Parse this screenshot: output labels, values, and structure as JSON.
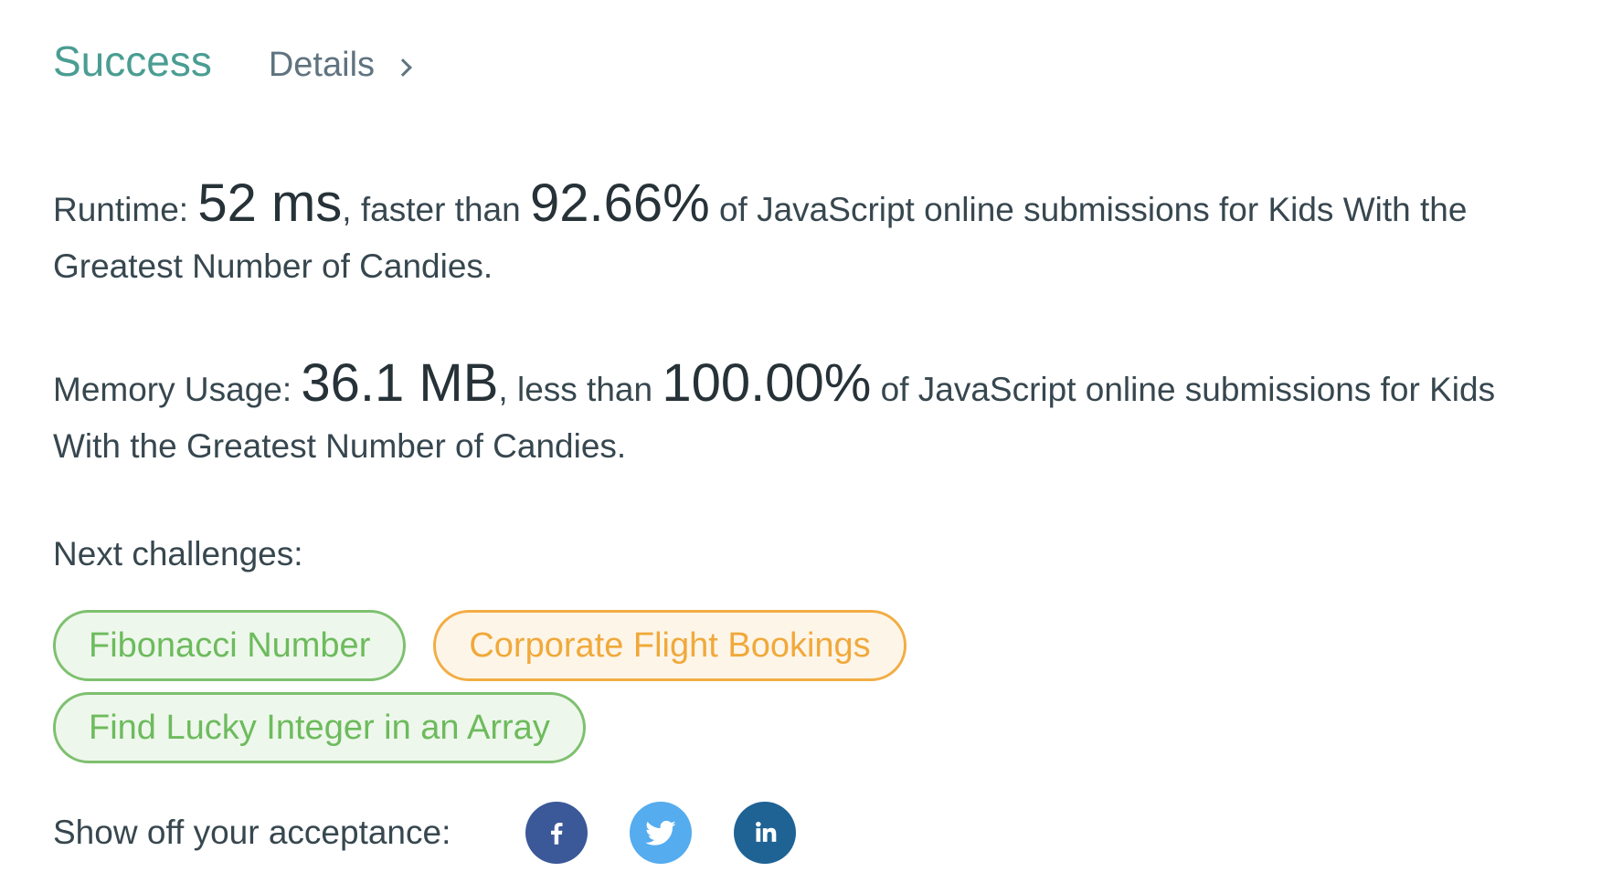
{
  "header": {
    "status": "Success",
    "details_label": "Details"
  },
  "runtime": {
    "label": "Runtime: ",
    "value": "52 ms",
    "comparison": ", faster than ",
    "percent": "92.66%",
    "suffix": " of JavaScript online submissions for Kids With the Greatest Number of Candies."
  },
  "memory": {
    "label": "Memory Usage: ",
    "value": "36.1 MB",
    "comparison": ", less than ",
    "percent": "100.00%",
    "suffix": " of JavaScript online submissions for Kids With the Greatest Number of Candies."
  },
  "next": {
    "label": "Next challenges:",
    "challenges": [
      {
        "title": "Fibonacci Number",
        "difficulty": "easy"
      },
      {
        "title": "Corporate Flight Bookings",
        "difficulty": "medium"
      },
      {
        "title": "Find Lucky Integer in an Array",
        "difficulty": "easy"
      }
    ]
  },
  "share": {
    "label": "Show off your acceptance:",
    "networks": [
      {
        "name": "facebook-icon",
        "color": "#3b5998"
      },
      {
        "name": "twitter-icon",
        "color": "#55acee"
      },
      {
        "name": "linkedin-icon",
        "color": "#1f6395"
      }
    ]
  },
  "colors": {
    "success": "#4a9d92",
    "easy": "#6dbb5d",
    "medium": "#f0a93a"
  }
}
